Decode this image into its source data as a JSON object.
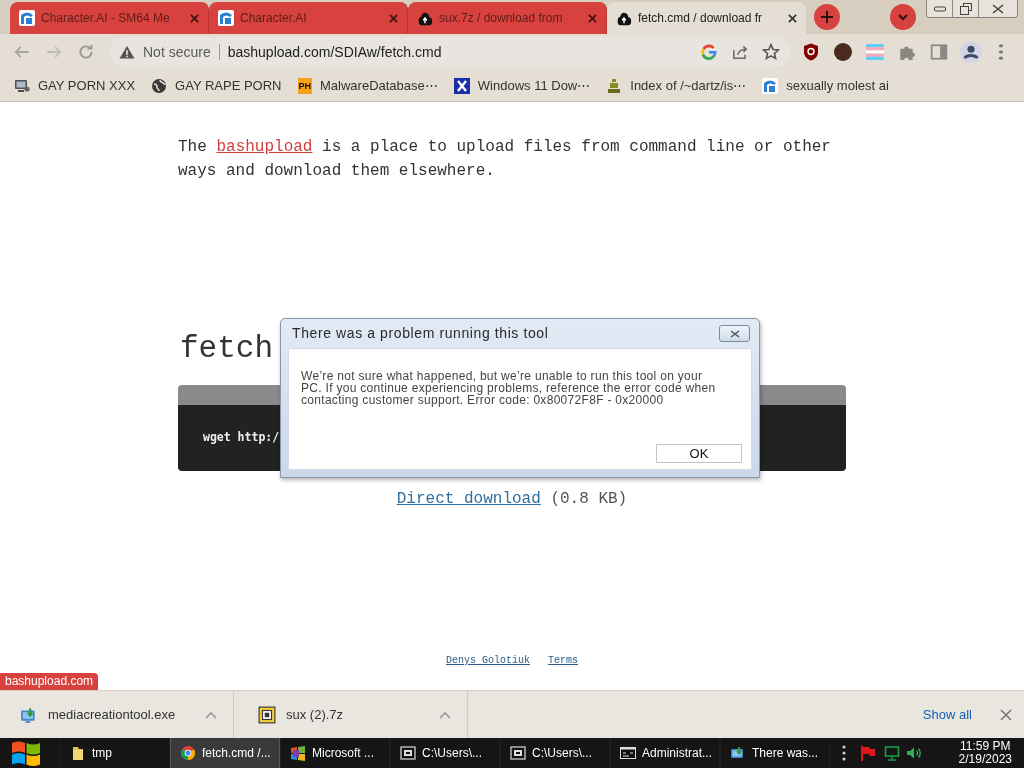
{
  "browser": {
    "tabs": [
      {
        "title": "Character.AI - SM64 Me",
        "kind": "character",
        "selected": false
      },
      {
        "title": "Character.AI",
        "kind": "character",
        "selected": false
      },
      {
        "title": "sux.7z / download from",
        "kind": "cloud",
        "selected": false
      },
      {
        "title": "fetch.cmd / download fr",
        "kind": "cloud",
        "selected": true
      }
    ],
    "address_bar": {
      "security": "Not secure",
      "url": "bashupload.com/SDIAw/fetch.cmd"
    },
    "bookmarks": [
      {
        "label": "GAY PORN XXX",
        "kind": "computer"
      },
      {
        "label": "GAY RAPE PORN",
        "kind": "globe"
      },
      {
        "label": "MalwareDatabase⋯",
        "kind": "badge",
        "badge": "PH"
      },
      {
        "label": "Windows 11 Dow⋯",
        "kind": "cross"
      },
      {
        "label": "Index of /~dartz/is⋯",
        "kind": "figure"
      },
      {
        "label": "sexually molest ai",
        "kind": "character"
      }
    ]
  },
  "page": {
    "intro": {
      "before": "The",
      "link": "bashupload",
      "after": "is a place to upload files from command line or other ways and download them elsewhere."
    },
    "heading": "fetch",
    "command": "wget http:/",
    "download": {
      "link": "Direct download",
      "size": "(0.8 KB)"
    },
    "footer_links": [
      "Denys Golotiuk",
      "Terms"
    ]
  },
  "status_bubble": "bashupload.com",
  "dialog": {
    "title": "There was a problem running this tool",
    "message": "We’re not sure what happened, but we’re unable to run this tool on your PC. If you continue experiencing problems, reference the error code when contacting customer support. Error code: 0x80072F8F - 0x20000",
    "button": "OK"
  },
  "downloads": {
    "items": [
      {
        "name": "mediacreationtool.exe",
        "kind": "installer"
      },
      {
        "name": "sux (2).7z",
        "kind": "archive"
      }
    ],
    "show_all": "Show all"
  },
  "taskbar": {
    "items": [
      {
        "label": "tmp",
        "kind": "folder",
        "selected": false
      },
      {
        "label": "fetch.cmd /...",
        "kind": "chrome",
        "selected": true
      },
      {
        "label": "Microsoft ...",
        "kind": "office",
        "selected": false
      },
      {
        "label": "C:\\Users\\...",
        "kind": "archive",
        "selected": false
      },
      {
        "label": "C:\\Users\\...",
        "kind": "archive",
        "selected": false
      },
      {
        "label": "Administrat...",
        "kind": "console",
        "selected": false
      },
      {
        "label": "There was...",
        "kind": "installer",
        "selected": false
      }
    ],
    "clock": {
      "time": "11:59 PM",
      "date": "2/19/2023"
    }
  }
}
